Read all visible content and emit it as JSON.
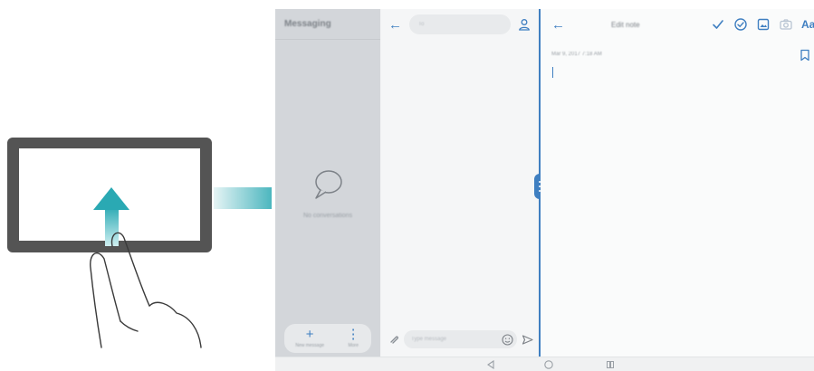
{
  "icons": {
    "tablet": "tablet-landscape-icon",
    "swipe_arrow": "swipe-up-arrow-icon",
    "hand": "two-finger-hand-icon",
    "transition_arrow": "right-arrow-icon",
    "empty_state": "speech-bubble-icon",
    "back": "back-arrow-icon",
    "contact": "person-icon",
    "attach": "paperclip-icon",
    "emoji": "smiley-icon",
    "send": "send-icon",
    "check": "check-icon",
    "checklist": "circle-check-icon",
    "image": "image-icon",
    "camera": "camera-icon",
    "bookmark": "bookmark-icon",
    "nav_back": "triangle-back-icon",
    "nav_home": "circle-home-icon",
    "nav_recent": "square-recent-icon"
  },
  "messaging": {
    "title": "Messaging",
    "empty_text": "No conversations",
    "new_label": "New message",
    "more_label": "More"
  },
  "conversation": {
    "recipient_placeholder": "To",
    "compose_placeholder": "Type message"
  },
  "notepad": {
    "title": "Edit note",
    "date": "Mar 9, 2017 7:18 AM",
    "font_label": "Aa"
  },
  "colors": {
    "accent": "#3f7fc1",
    "teal_gradient_start": "#e6f4f5",
    "teal_gradient_end": "#2aa9b3",
    "tablet_frame": "#545454",
    "messaging_bg": "#d3d6da"
  }
}
